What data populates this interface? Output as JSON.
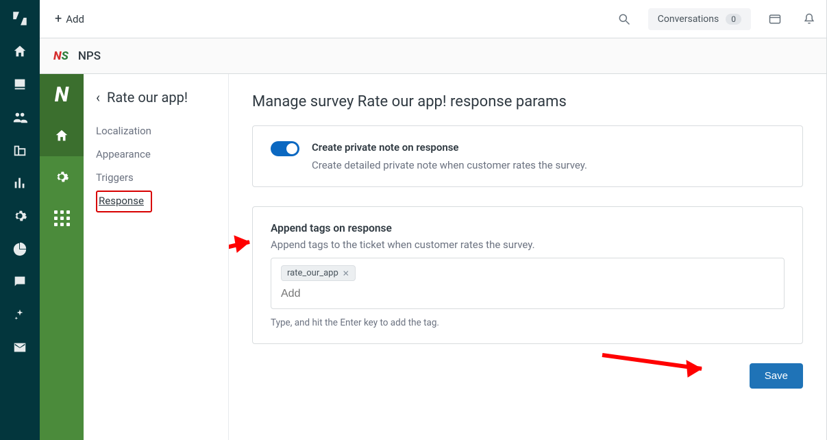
{
  "topbar": {
    "add_label": "Add",
    "conversations_label": "Conversations",
    "conversations_count": "0"
  },
  "app": {
    "icon_text_n": "N",
    "icon_text_s": "S",
    "name": "NPS"
  },
  "subnav": {
    "back_title": "Rate our app!",
    "items": {
      "localization": "Localization",
      "appearance": "Appearance",
      "triggers": "Triggers",
      "response": "Response"
    }
  },
  "content": {
    "title": "Manage survey Rate our app! response params",
    "note_card": {
      "toggle_title": "Create private note on response",
      "toggle_desc": "Create detailed private note when customer rates the survey."
    },
    "tags_card": {
      "label": "Append tags on response",
      "desc": "Append tags to the ticket when customer rates the survey.",
      "tag_value": "rate_our_app",
      "input_placeholder": "Add",
      "hint": "Type, and hit the Enter key to add the tag."
    },
    "save_label": "Save"
  }
}
